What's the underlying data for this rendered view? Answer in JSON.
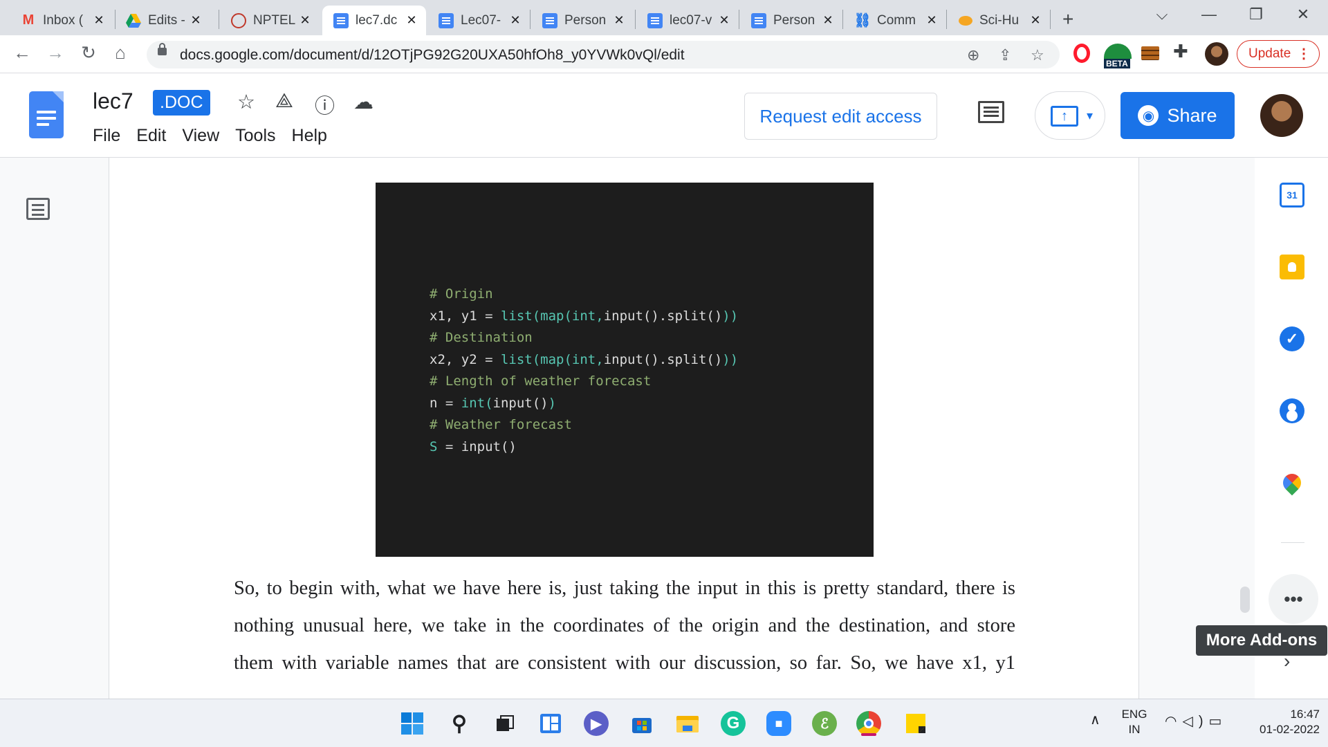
{
  "browser": {
    "tabs": [
      {
        "title": "Inbox (",
        "icon": "gmail-icon"
      },
      {
        "title": "Edits -",
        "icon": "drive-icon"
      },
      {
        "title": "NPTEL",
        "icon": "nptel-icon"
      },
      {
        "title": "lec7.dc",
        "icon": "docs-icon",
        "active": true
      },
      {
        "title": "Lec07-",
        "icon": "docs-icon"
      },
      {
        "title": "Person",
        "icon": "docs-icon"
      },
      {
        "title": "lec07-v",
        "icon": "docs-icon"
      },
      {
        "title": "Person",
        "icon": "docs-icon"
      },
      {
        "title": "Comm",
        "icon": "link-icon"
      },
      {
        "title": "Sci-Hu",
        "icon": "scihub-icon"
      }
    ],
    "url": "docs.google.com/document/d/12OTjPG92G20UXA50hfOh8_y0YVWk0vQl/edit",
    "update_label": "Update",
    "beta_label": "BETA"
  },
  "docs": {
    "title": "lec7",
    "badge": ".DOC",
    "menu": [
      "File",
      "Edit",
      "View",
      "Tools",
      "Help"
    ],
    "request_edit_label": "Request edit access",
    "share_label": "Share"
  },
  "document": {
    "code_lines": [
      [
        {
          "t": "# Origin",
          "c": "c-cmt"
        }
      ],
      [
        {
          "t": "x1, y1",
          "c": "c-var"
        },
        {
          "t": " = ",
          "c": "c-op"
        },
        {
          "t": "list(map(int,",
          "c": "c-bi"
        },
        {
          "t": "input().split()",
          "c": "c-var"
        },
        {
          "t": "))",
          "c": "c-bi"
        }
      ],
      [
        {
          "t": "# Destination",
          "c": "c-cmt"
        }
      ],
      [
        {
          "t": "x2, y2",
          "c": "c-var"
        },
        {
          "t": " = ",
          "c": "c-op"
        },
        {
          "t": "list(map(int,",
          "c": "c-bi"
        },
        {
          "t": "input().split()",
          "c": "c-var"
        },
        {
          "t": "))",
          "c": "c-bi"
        }
      ],
      [
        {
          "t": "# Length of weather forecast",
          "c": "c-cmt"
        }
      ],
      [
        {
          "t": "n",
          "c": "c-var"
        },
        {
          "t": " = ",
          "c": "c-op"
        },
        {
          "t": "int(",
          "c": "c-bi"
        },
        {
          "t": "input()",
          "c": "c-var"
        },
        {
          "t": ")",
          "c": "c-bi"
        }
      ],
      [
        {
          "t": "# Weather forecast",
          "c": "c-cmt"
        }
      ],
      [
        {
          "t": "S",
          "c": "c-bi"
        },
        {
          "t": " = ",
          "c": "c-op"
        },
        {
          "t": "input()",
          "c": "c-var"
        }
      ]
    ],
    "paragraph_lines": [
      "So, to begin with, what we have here is, just taking the input in this is pretty standard, there is",
      "nothing unusual here, we take in the coordinates of the origin and the destination, and store",
      "them with variable names that are consistent with our discussion, so far. So, we have x1, y1"
    ]
  },
  "sidepanel": {
    "calendar_day": "31",
    "more_addons_tooltip": "More Add-ons"
  },
  "taskbar": {
    "apps": [
      "windows-start-icon",
      "search-icon",
      "task-view-icon",
      "widgets-icon",
      "teams-chat-icon",
      "store-icon",
      "file-explorer-icon",
      "grammarly-icon",
      "zoom-icon",
      "evernote-icon",
      "chrome-icon",
      "sticky-notes-icon"
    ],
    "lang_top": "ENG",
    "lang_bottom": "IN",
    "time": "16:47",
    "date": "01-02-2022"
  },
  "colors": {
    "accent": "#1a73e8",
    "code_bg": "#1d1d1d",
    "comment": "#8fae71",
    "builtin": "#57c7b3"
  }
}
